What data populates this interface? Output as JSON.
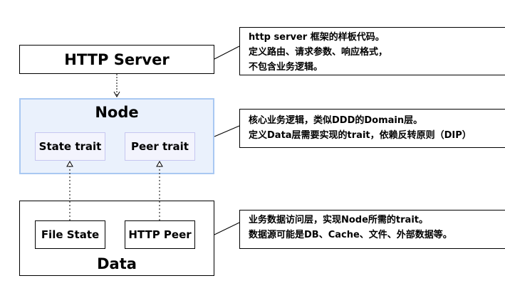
{
  "layers": {
    "http_server": {
      "title": "HTTP Server"
    },
    "node": {
      "title": "Node",
      "traits": [
        "State trait",
        "Peer trait"
      ]
    },
    "data": {
      "title": "Data",
      "impls": [
        "File State",
        "HTTP Peer"
      ]
    }
  },
  "notes": {
    "http_server": [
      "http server 框架的样板代码。",
      "定义路由、请求参数、响应格式，",
      "不包含业务逻辑。"
    ],
    "node": [
      "核心业务逻辑，类似DDD的Domain层。",
      "定义Data层需要实现的trait，依赖反转原则（DIP）"
    ],
    "data": [
      "业务数据访问层，实现Node所需的trait。",
      "数据源可能是DB、Cache、文件、外部数据等。"
    ]
  },
  "colors": {
    "node_fill": "#eaf1fc",
    "node_border": "#a9c8f2",
    "trait_fill": "#f3f4fd",
    "trait_border": "#c6c6f0",
    "line": "#000000"
  }
}
